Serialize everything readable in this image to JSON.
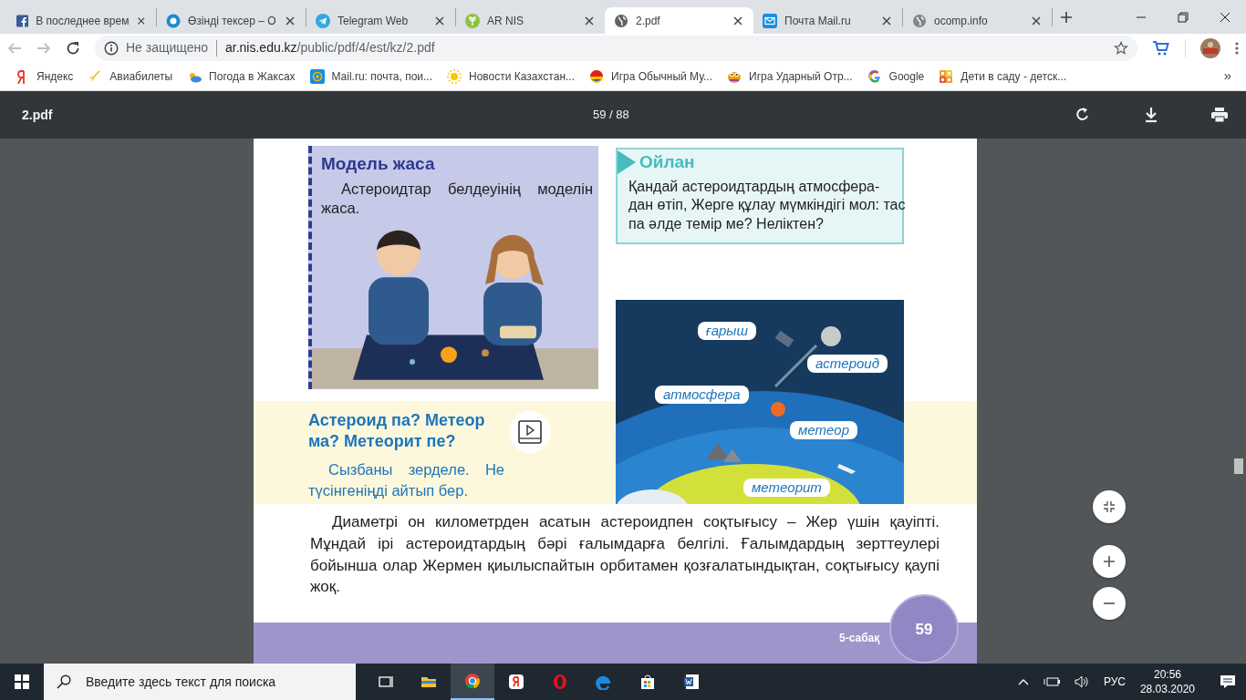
{
  "browser": {
    "tabs": [
      {
        "title": "В последнее врем",
        "selected": false
      },
      {
        "title": "Өзінді тексер – О",
        "selected": false
      },
      {
        "title": "Telegram Web",
        "selected": false
      },
      {
        "title": "AR NIS",
        "selected": false
      },
      {
        "title": "2.pdf",
        "selected": true
      },
      {
        "title": "Почта Mail.ru",
        "selected": false
      },
      {
        "title": "ocomp.info",
        "selected": false
      }
    ],
    "security_label": "Не защищено",
    "url_host": "ar.nis.edu.kz",
    "url_path": "/public/pdf/4/est/kz/2.pdf",
    "bookmarks": [
      "Яндекс",
      "Авиабилеты",
      "Погода в Жаксах",
      "Mail.ru: почта, пои...",
      "Новости Казахстан...",
      "Игра Обычный Му...",
      "Игра Ударный Отр...",
      "Google",
      "Дети в саду - детск..."
    ],
    "bookmarks_more": "»"
  },
  "pdf_viewer": {
    "title": "2.pdf",
    "page_counter": "59 / 88"
  },
  "page": {
    "model": {
      "title": "Модель жаса",
      "text": "Астероидтар белдеуінің моделін жаса."
    },
    "think": {
      "title": "Ойлан",
      "lines": [
        "Қандай астероидтардың атмосфера-",
        "дан өтіп, Жерге құлау мүмкіндігі мол: тас",
        "па әлде темір ме? Неліктен?"
      ]
    },
    "video_task": {
      "title": "Астероид па? Метеор ма? Метеорит пе?",
      "text": "Сызбаны зерделе. Не түсінгеніңді айтып бер."
    },
    "diagram_labels": [
      "ғарыш",
      "астероид",
      "атмосфера",
      "метеор",
      "метеорит"
    ],
    "paragraph": "Диаметрі он километрден асатын астероидпен соқтығысу – Жер үшін қауіпті. Мұндай ірі астероидтардың бәрі ғалымдарға белгілі. Ғалымдардың зерттеулері бойынша олар Жермен қиылыспайтын орбитамен қозғалатындықтан, соқтығысу қаупі жоқ.",
    "lesson": "5-сабақ",
    "page_number": "59"
  },
  "taskbar": {
    "search_placeholder": "Введите здесь текст для поиска",
    "apps": [
      {
        "selected": false
      },
      {
        "selected": false
      },
      {
        "selected": true
      },
      {
        "selected": false
      },
      {
        "selected": false
      },
      {
        "selected": false
      },
      {
        "selected": false
      },
      {
        "selected": false
      }
    ],
    "language": "РУС",
    "time": "20:56",
    "date": "28.03.2020"
  }
}
